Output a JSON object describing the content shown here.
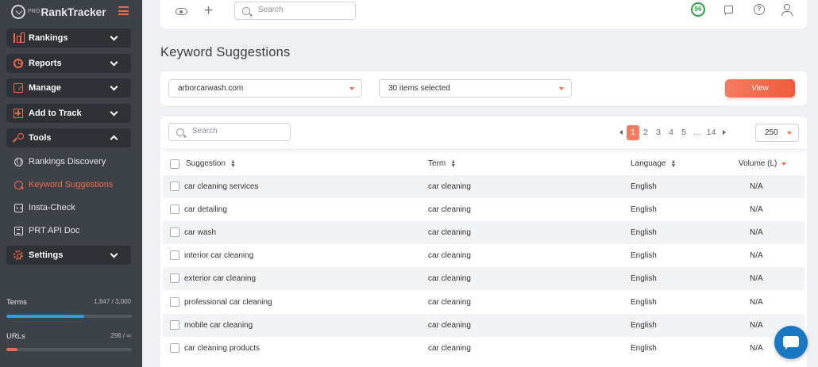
{
  "app": {
    "brand_prefix": "PRO",
    "brand_name": "RankTracker"
  },
  "sidebar": {
    "groups": [
      {
        "label": "Rankings",
        "icon": "bar-chart-icon"
      },
      {
        "label": "Reports",
        "icon": "pie-chart-icon"
      },
      {
        "label": "Manage",
        "icon": "edit-icon"
      },
      {
        "label": "Add to Track",
        "icon": "plus-square-icon"
      },
      {
        "label": "Tools",
        "icon": "tools-icon"
      },
      {
        "label": "Settings",
        "icon": "gear-icon"
      }
    ],
    "tool_items": [
      {
        "label": "Rankings Discovery",
        "icon": "globe-icon",
        "active": false
      },
      {
        "label": "Keyword Suggestions",
        "icon": "keyword-search-icon",
        "active": true
      },
      {
        "label": "Insta-Check",
        "icon": "calendar-icon",
        "active": false
      },
      {
        "label": "PRT API Doc",
        "icon": "document-icon",
        "active": false
      }
    ],
    "usage": {
      "terms_label": "Terms",
      "terms_value": "1,847 / 3,000",
      "terms_fraction": 0.62,
      "terms_color": "#2f9be6",
      "urls_label": "URLs",
      "urls_value": "296 / ∞",
      "urls_fraction": 0.09,
      "urls_color": "#f16a4a"
    }
  },
  "topbar": {
    "search_placeholder": "Search",
    "score": "96"
  },
  "page": {
    "title": "Keyword Suggestions"
  },
  "filters": {
    "domain": "arborcarwash.com",
    "items": "30 items selected",
    "view_label": "View"
  },
  "table": {
    "search_placeholder": "Search",
    "pagination": {
      "pages": [
        "1",
        "2",
        "3",
        "4",
        "5",
        "...",
        "14"
      ],
      "current": "1"
    },
    "per_page": "250",
    "columns": {
      "suggestion": "Suggestion",
      "term": "Term",
      "language": "Language",
      "volume": "Volume (L)"
    },
    "rows": [
      {
        "suggestion": "car cleaning services",
        "term": "car cleaning",
        "language": "English",
        "volume": "N/A"
      },
      {
        "suggestion": "car detailing",
        "term": "car cleaning",
        "language": "English",
        "volume": "N/A"
      },
      {
        "suggestion": "car wash",
        "term": "car cleaning",
        "language": "English",
        "volume": "N/A"
      },
      {
        "suggestion": "interior car cleaning",
        "term": "car cleaning",
        "language": "English",
        "volume": "N/A"
      },
      {
        "suggestion": "exterior car cleaning",
        "term": "car cleaning",
        "language": "English",
        "volume": "N/A"
      },
      {
        "suggestion": "professional car cleaning",
        "term": "car cleaning",
        "language": "English",
        "volume": "N/A"
      },
      {
        "suggestion": "mobile car cleaning",
        "term": "car cleaning",
        "language": "English",
        "volume": "N/A"
      },
      {
        "suggestion": "car cleaning products",
        "term": "car cleaning",
        "language": "English",
        "volume": "N/A"
      }
    ]
  },
  "colors": {
    "accent": "#f16a4a",
    "sidebar_bg": "#3d4148",
    "score_green": "#28a745",
    "chat_blue": "#1a78c2"
  }
}
